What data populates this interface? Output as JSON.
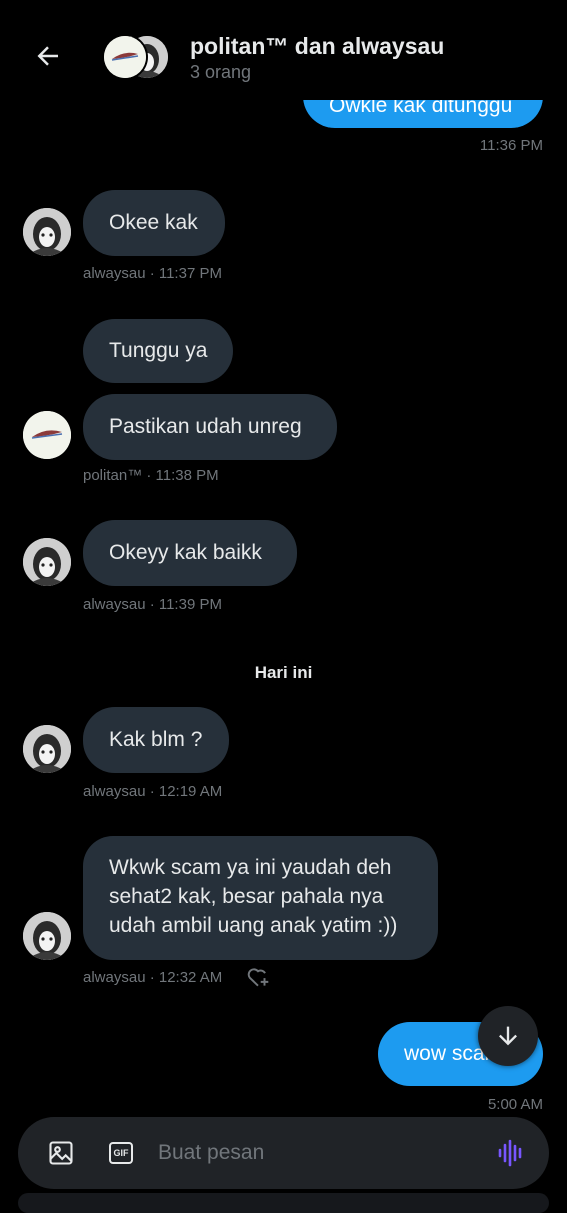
{
  "header": {
    "title": "politan™ dan alwaysau",
    "subtitle": "3 orang"
  },
  "messages": {
    "m0": {
      "text": "Owkle kak ditunggu",
      "time": "11:36 PM"
    },
    "m1": {
      "text": "Okee kak",
      "meta": "alwaysau · 11:37 PM"
    },
    "m2": {
      "text": "Tunggu ya"
    },
    "m3": {
      "text": "Pastikan udah unreg",
      "meta": "politan™ · 11:38 PM"
    },
    "m4": {
      "text": "Okeyy kak baikk",
      "meta": "alwaysau · 11:39 PM"
    },
    "day_separator": "Hari ini",
    "m5": {
      "text": "Kak blm ?",
      "meta": "alwaysau · 12:19 AM"
    },
    "m6": {
      "text": "Wkwk scam ya ini yaudah deh sehat2 kak, besar pahala nya udah ambil uang anak yatim :))",
      "meta": "alwaysau · 12:32 AM"
    },
    "m7": {
      "text": "wow scam",
      "time": "5:00 AM"
    }
  },
  "composer": {
    "placeholder": "Buat pesan",
    "gif_label": "GIF"
  },
  "icons": {
    "back": "arrow-left-icon",
    "image": "image-icon",
    "gif": "gif-icon",
    "voice": "voice-waveform-icon",
    "scroll": "arrow-down-icon",
    "react": "heart-plus-icon"
  },
  "colors": {
    "background": "#000000",
    "received_bubble": "#26303a",
    "sent_bubble": "#1d9bf0",
    "voice_accent": "#7856ff"
  }
}
